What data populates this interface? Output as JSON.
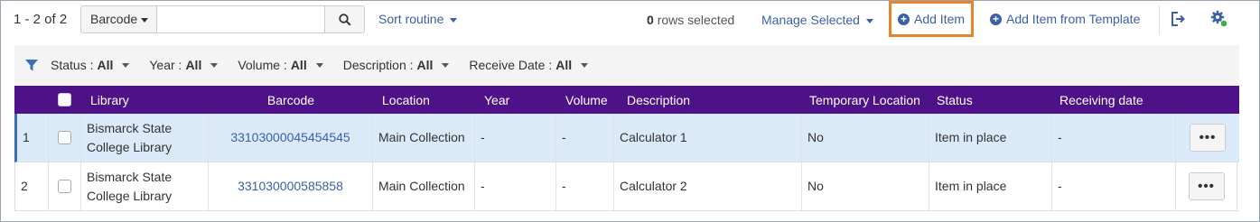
{
  "toolbar": {
    "count": "1 - 2 of 2",
    "search_type": "Barcode",
    "search_value": "",
    "sort_label": "Sort routine",
    "rows_selected_num": "0",
    "rows_selected_text": "rows selected",
    "manage_label": "Manage Selected",
    "add_item_label": "Add Item",
    "add_template_label": "Add Item from Template"
  },
  "filters": [
    {
      "label": "Status :",
      "value": "All"
    },
    {
      "label": "Year :",
      "value": "All"
    },
    {
      "label": "Volume :",
      "value": "All"
    },
    {
      "label": "Description :",
      "value": "All"
    },
    {
      "label": "Receive Date :",
      "value": "All"
    }
  ],
  "table": {
    "headers": {
      "library": "Library",
      "barcode": "Barcode",
      "location": "Location",
      "year": "Year",
      "volume": "Volume",
      "description": "Description",
      "temp_location": "Temporary Location",
      "status": "Status",
      "receiving_date": "Receiving date"
    },
    "rows": [
      {
        "num": "1",
        "library": "Bismarck State College Library",
        "barcode": "33103000045454545",
        "location": "Main Collection",
        "year": "-",
        "volume": "-",
        "description": "Calculator 1",
        "temp_location": "No",
        "status": "Item in place",
        "receiving_date": "-",
        "actions": "•••"
      },
      {
        "num": "2",
        "library": "Bismarck State College Library",
        "barcode": "331030000585858",
        "location": "Main Collection",
        "year": "-",
        "volume": "-",
        "description": "Calculator 2",
        "temp_location": "No",
        "status": "Item in place",
        "receiving_date": "-",
        "actions": "•••"
      }
    ]
  },
  "colors": {
    "header_bg": "#4f1187",
    "link": "#3b5fa8",
    "highlight_border": "#e8832a",
    "selected_row": "#dbeaf9",
    "gear_badge": "#3cb043"
  }
}
